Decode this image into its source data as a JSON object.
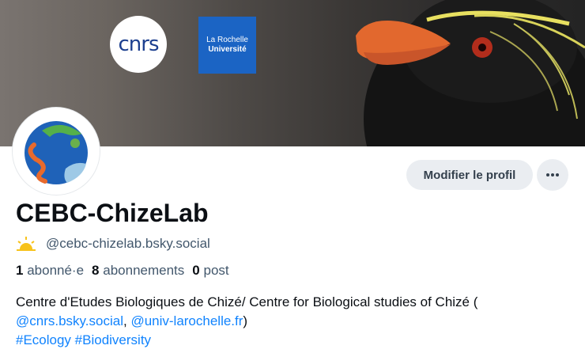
{
  "banner": {
    "logos": {
      "cnrs": "cnrs",
      "univ_line1": "La Rochelle",
      "univ_line2": "Université"
    }
  },
  "profile": {
    "display_name": "CEBC-ChizeLab",
    "handle": "@cebc-chizelab.bsky.social",
    "badge_icon": "sun-icon",
    "stats": {
      "followers_count": "1",
      "followers_label": "abonné·e",
      "following_count": "8",
      "following_label": "abonnements",
      "posts_count": "0",
      "posts_label": "post"
    },
    "bio": {
      "line1": "Centre d'Etudes Biologiques de Chizé/ Centre for Biological studies of Chizé (",
      "mention1": "@cnrs.bsky.social",
      "sep": ", ",
      "mention2": "@univ-larochelle.fr",
      "close": ")",
      "tag1": "#Ecology",
      "tag2": "#Biodiversity"
    }
  },
  "actions": {
    "edit_label": "Modifier le profil",
    "more_icon": "more-horizontal-icon"
  },
  "colors": {
    "link": "#1083fe",
    "button_bg": "#eaedf1",
    "muted_text": "#42576c"
  }
}
